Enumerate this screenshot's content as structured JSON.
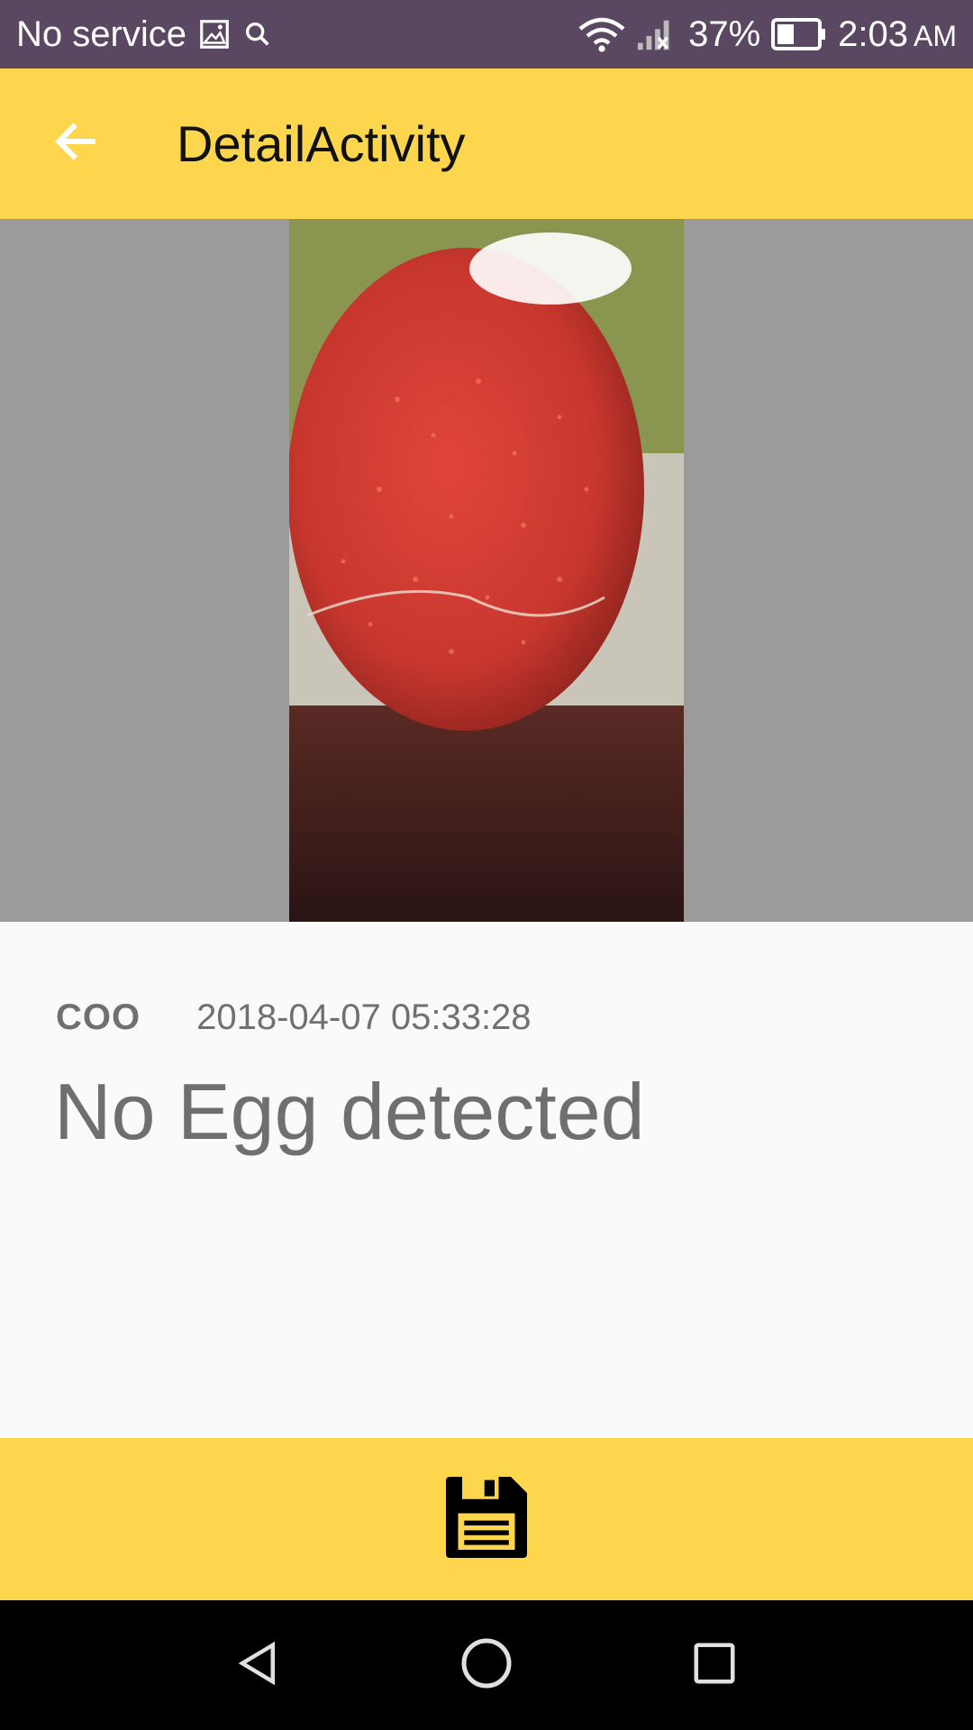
{
  "status_bar": {
    "carrier": "No service",
    "battery": "37%",
    "time": "2:03",
    "time_suffix": "AM",
    "icons": [
      "image-icon",
      "search-icon",
      "wifi-icon",
      "signal-icon",
      "battery-icon"
    ]
  },
  "toolbar": {
    "title": "DetailActivity",
    "back_icon": "arrow-back-icon"
  },
  "photo": {
    "alt": "egg candling photo"
  },
  "detail": {
    "name": "COO",
    "timestamp": "2018-04-07 05:33:28",
    "result": "No Egg detected"
  },
  "action_bar": {
    "save_icon": "floppy-disk-icon"
  },
  "nav_bar": {
    "icons": [
      "back-triangle-icon",
      "home-circle-icon",
      "recents-square-icon"
    ]
  },
  "colors": {
    "accent": "#FDD64E",
    "status_bar": "#5A4863",
    "image_bg": "#9B9B9B"
  }
}
